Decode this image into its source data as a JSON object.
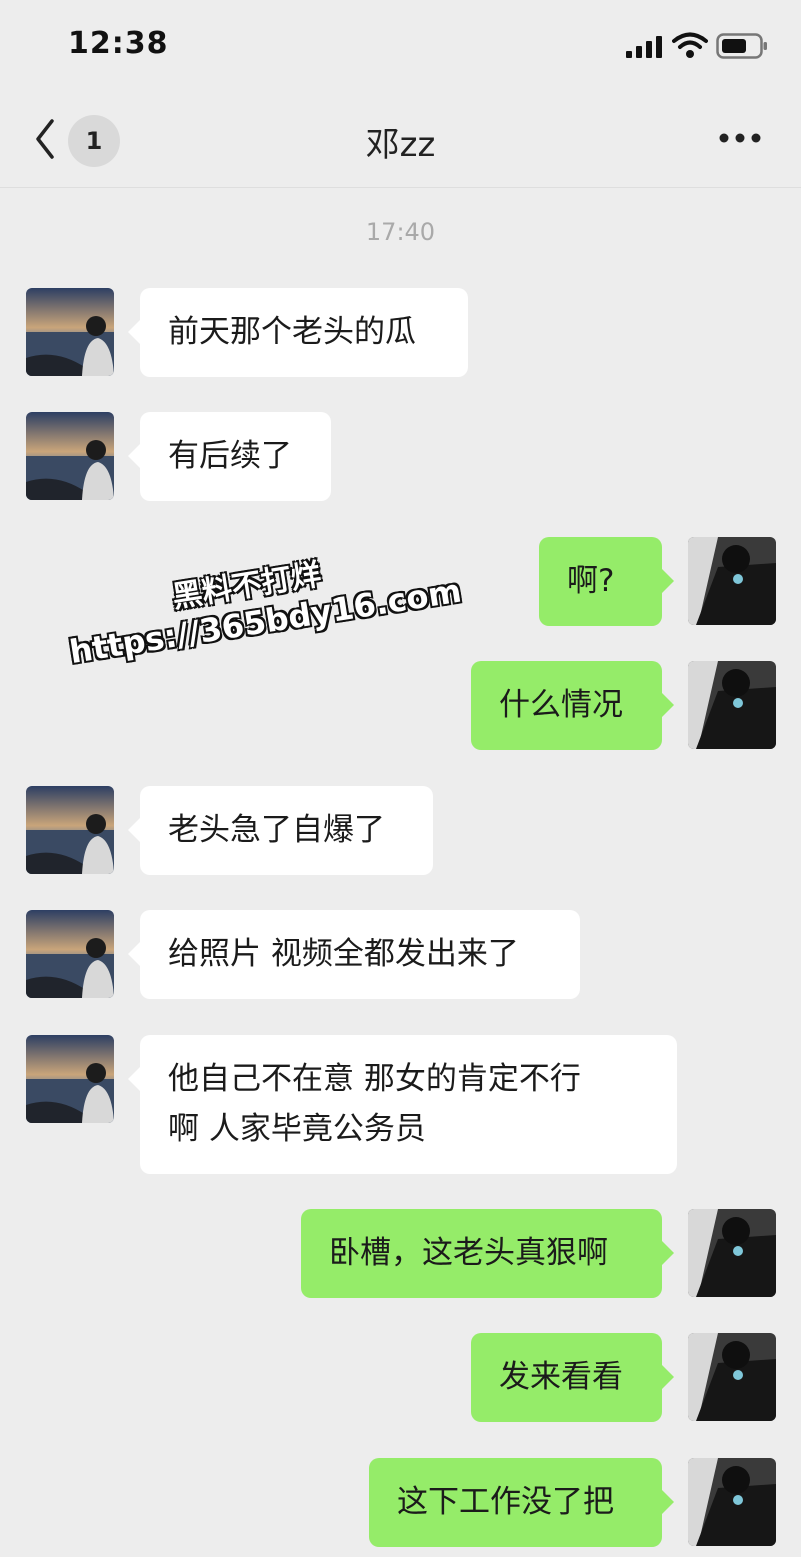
{
  "status_bar": {
    "time": "12:38"
  },
  "nav": {
    "unread_count": "1",
    "title": "邓zz"
  },
  "timestamp": "17:40",
  "messages": [
    {
      "side": "in",
      "lines": [
        "前天那个老头的瓜"
      ]
    },
    {
      "side": "in",
      "lines": [
        "有后续了"
      ]
    },
    {
      "side": "out",
      "lines": [
        "啊?"
      ]
    },
    {
      "side": "out",
      "lines": [
        "什么情况"
      ]
    },
    {
      "side": "in",
      "lines": [
        "老头急了自爆了"
      ]
    },
    {
      "side": "in",
      "lines": [
        "给照片 视频全都发出来了"
      ]
    },
    {
      "side": "in",
      "lines": [
        "他自己不在意 那女的肯定不行",
        "啊 人家毕竟公务员"
      ]
    },
    {
      "side": "out",
      "lines": [
        "卧槽，这老头真狠啊"
      ]
    },
    {
      "side": "out",
      "lines": [
        "发来看看"
      ]
    },
    {
      "side": "out",
      "lines": [
        "这下工作没了把"
      ]
    }
  ],
  "watermark": {
    "line1": "黑料不打烊",
    "line2": "https://365bdy16.com"
  },
  "colors": {
    "background": "#ededed",
    "outgoing_bubble": "#95ec69",
    "incoming_bubble": "#ffffff",
    "timestamp": "#a9a9a9"
  },
  "icons": {
    "back": "chevron-left-icon",
    "more": "more-dots-icon",
    "signal": "signal-icon",
    "wifi": "wifi-icon",
    "battery": "battery-icon"
  }
}
